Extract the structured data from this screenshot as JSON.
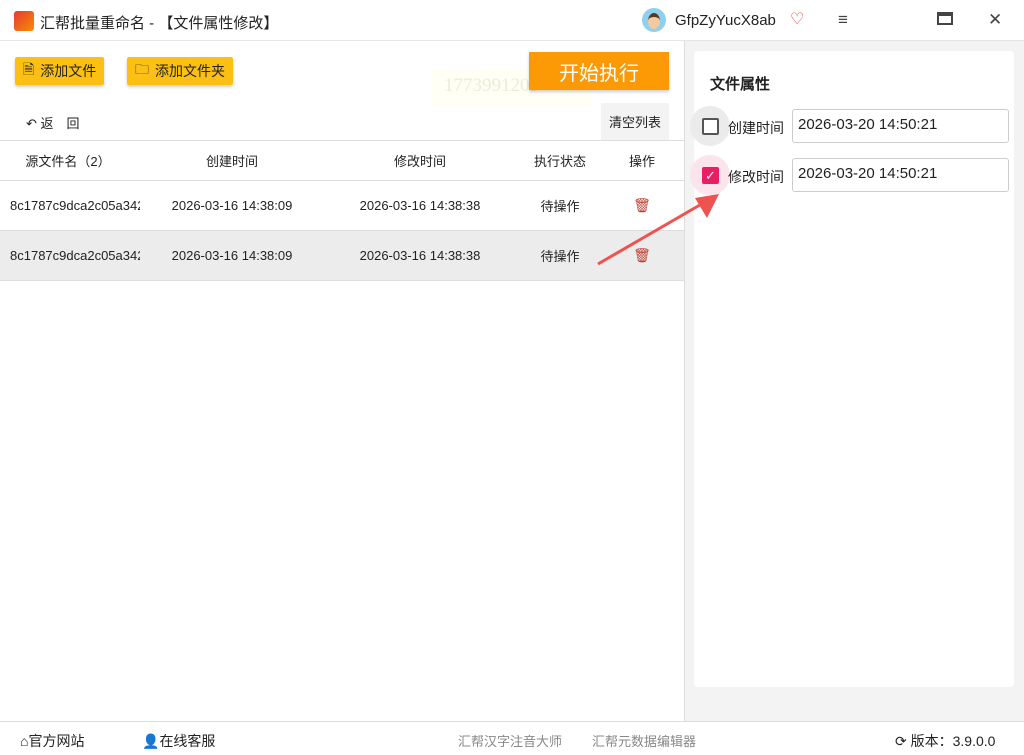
{
  "window": {
    "title": "汇帮批量重命名 - 【文件属性修改】",
    "user": "GfpZyYucX8ab"
  },
  "toolbar": {
    "add_file": "添加文件",
    "add_folder": "添加文件夹",
    "start": "开始执行",
    "watermark": "1773991209",
    "back": "返　回",
    "clear": "清空列表"
  },
  "table": {
    "headers": [
      "源文件名（2）",
      "创建时间",
      "修改时间",
      "执行状态",
      "操作"
    ],
    "rows": [
      {
        "name": "8c1787c9dca2c05a342",
        "created": "2026-03-16 14:38:09",
        "modified": "2026-03-16 14:38:38",
        "status": "待操作"
      },
      {
        "name": "8c1787c9dca2c05a342",
        "created": "2026-03-16 14:38:09",
        "modified": "2026-03-16 14:38:38",
        "status": "待操作"
      }
    ]
  },
  "panel": {
    "heading": "文件属性",
    "created_label": "创建时间",
    "created_value": "2026-03-20 14:50:21",
    "created_checked": false,
    "modified_label": "修改时间",
    "modified_value": "2026-03-20 14:50:21",
    "modified_checked": true
  },
  "footer": {
    "website": "官方网站",
    "support": "在线客服",
    "link1": "汇帮汉字注音大师",
    "link2": "汇帮元数据编辑器",
    "version": "版本：3.9.0.0"
  },
  "colors": {
    "accent": "#fb9a05",
    "button": "#fcbf14",
    "check": "#e91e63"
  }
}
